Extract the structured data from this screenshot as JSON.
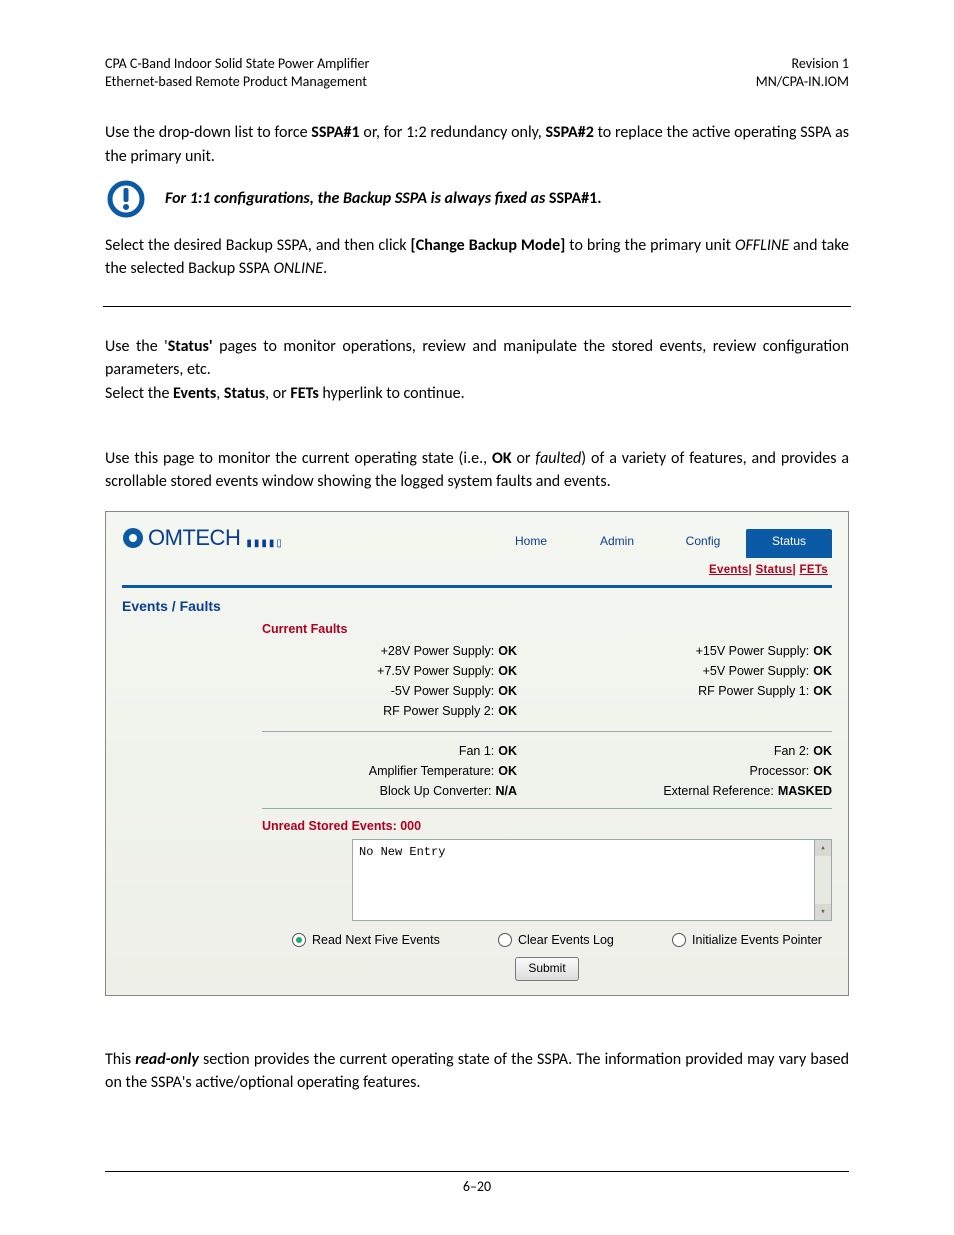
{
  "header": {
    "left_line1": "CPA C-Band Indoor Solid State Power Amplifier",
    "left_line2": "Ethernet-based Remote Product Management",
    "right_line1": "Revision 1",
    "right_line2": "MN/CPA-IN.IOM"
  },
  "para1_a": "Use the drop-down list to force ",
  "para1_b": "SSPA#1",
  "para1_c": " or, for 1:2 redundancy only, ",
  "para1_d": "SSPA#2",
  "para1_e": " to replace the active operating SSPA as the primary unit.",
  "note1_a": "For 1:1 configurations, the Backup SSPA is always fixed as ",
  "note1_b": "SSPA#1.",
  "para2_a": "Select the desired Backup SSPA, and then click ",
  "para2_b": "[Change Backup Mode]",
  "para2_c": " to bring the primary unit ",
  "para2_d": "OFFLINE",
  "para2_e": " and take the selected Backup SSPA ",
  "para2_f": "ONLINE",
  "para2_g": ".",
  "para3_a": "Use the '",
  "para3_b": "Status'",
  "para3_c": " pages to monitor operations, review and manipulate the stored events, review configuration parameters, etc.",
  "para4_a": "Select the ",
  "para4_b": "Events",
  "para4_c": ", ",
  "para4_d": "Status",
  "para4_e": ", or ",
  "para4_f": "FETs",
  "para4_g": " hyperlink to continue.",
  "para5_a": "Use this page to monitor the current operating state (i.e., ",
  "para5_b": "OK",
  "para5_c": " or ",
  "para5_d": "faulted",
  "para5_e": ") of a variety of features, and provides a scrollable stored events window showing the logged system faults and events.",
  "para6_a": "This ",
  "para6_b": "read-only",
  "para6_c": " section provides the current operating state of the SSPA. The information provided may vary based on the SSPA's active/optional operating features.",
  "footer": "6–20",
  "shot": {
    "brand": "OMTECH",
    "tabs": {
      "home": "Home",
      "admin": "Admin",
      "config": "Config",
      "status": "Status"
    },
    "subtabs": {
      "events": "Events",
      "status": "Status",
      "fets": "FETs"
    },
    "section_title": "Events / Faults",
    "current_faults_heading": "Current Faults",
    "faults": {
      "r1": {
        "lk": "+28V Power Supply:",
        "lv": "OK",
        "rk": "+15V Power Supply:",
        "rv": "OK"
      },
      "r2": {
        "lk": "+7.5V Power Supply:",
        "lv": "OK",
        "rk": "+5V Power Supply:",
        "rv": "OK"
      },
      "r3": {
        "lk": "-5V Power Supply:",
        "lv": "OK",
        "rk": "RF Power Supply 1:",
        "rv": "OK"
      },
      "r4": {
        "lk": "RF Power Supply 2:",
        "lv": "OK"
      },
      "r5": {
        "lk": "Fan 1:",
        "lv": "OK",
        "rk": "Fan 2:",
        "rv": "OK"
      },
      "r6": {
        "lk": "Amplifier Temperature:",
        "lv": "OK",
        "rk": "Processor:",
        "rv": "OK"
      },
      "r7": {
        "lk": "Block Up Converter:",
        "lv": "N/A",
        "rk": "External Reference:",
        "rv": "MASKED"
      }
    },
    "unread_heading": "Unread Stored Events: 000",
    "events_text": "No New Entry",
    "radios": {
      "a": "Read Next Five Events",
      "b": "Clear Events Log",
      "c": "Initialize Events Pointer"
    },
    "submit": "Submit"
  }
}
